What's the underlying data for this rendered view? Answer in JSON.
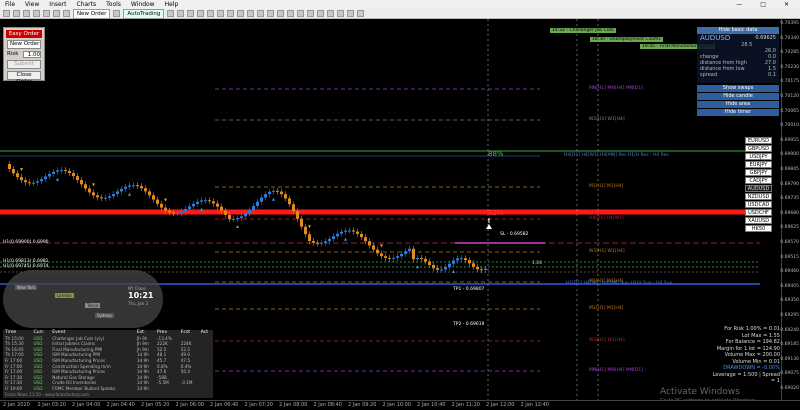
{
  "menu": [
    "File",
    "View",
    "Insert",
    "Charts",
    "Tools",
    "Window",
    "Help"
  ],
  "toolbar": {
    "new_order": "New Order",
    "auto_trading": "AutoTrading"
  },
  "easy_order": {
    "title": "Easy Order",
    "type": "New Order",
    "lots_label": "Risk",
    "lots_value": "1.00",
    "submit": "Submit",
    "close": "Close Order"
  },
  "info_panel": {
    "hide": "Hide basic data",
    "symbol": "AUDUSD",
    "price": "0.69625",
    "rows": [
      [
        "",
        "28.5"
      ],
      [
        "",
        "26.0"
      ],
      [
        "change",
        "0.0"
      ],
      [
        "distance from high",
        "27.0"
      ],
      [
        "distance from low",
        "1.5"
      ],
      [
        "spread",
        "0.1"
      ]
    ]
  },
  "right_buttons": [
    "Show swaps",
    "Hide candle",
    "Hide area",
    "Hide timer"
  ],
  "pairs": [
    "EURUSD",
    "GBPUSD",
    "USDJPY",
    "EURJPY",
    "GBPJPY",
    "CADJPY",
    "AUDUSD",
    "NZDUSD",
    "USDCAD",
    "USDCHF",
    "XAUUSD",
    "HK50"
  ],
  "pair_active": "AUDUSD",
  "chart": {
    "labels": {
      "fib88": "88%",
      "fib62": "62%",
      "sl": "SL - 0.69582",
      "tp1": "TP1 - 0.69807",
      "tp2": "TP2 - 0.69619",
      "count": "1:26"
    },
    "top_tags": [
      "14:32 - Challenger Job Cuts",
      "18:30 - Unemployment Claims",
      "19:45 - Final Manufacturing PMI"
    ],
    "level_labels": [
      "MN[H1] MN[H4] MN[D1]",
      "W1[H1] W1[H4]",
      "H4[D1] H4[W1] H4[MN] Res H1/H Res - H4 Res",
      "M1[H1] M1[H4]",
      "H4[D1] H4[W1]",
      "W1[H1] W1[H4]",
      "M1[H1] M1[H4]",
      "H1[D1] H4[W1] H4[MN] Sup H1/H Sup - H4 Sup",
      "M1[H1] M1[H4]",
      "W1[H1] W1[H4]",
      "MN[H1] MN[H4] MN[D1]"
    ],
    "left_tags": [
      "H1(0.69900) 0.6990",
      "H1(0.69813) 0.6981",
      "H1(0.69745) 0.6974"
    ]
  },
  "price_axis": [
    "0.70395",
    "0.70340",
    "0.70285",
    "0.70230",
    "0.70175",
    "0.70120",
    "0.70065",
    "0.70010",
    "0.69955",
    "0.69900",
    "0.69845",
    "0.69790",
    "0.69735",
    "0.69680",
    "0.69625",
    "0.69570",
    "0.69515",
    "0.69460",
    "0.69405",
    "0.69350",
    "0.69295",
    "0.69240",
    "0.69185",
    "0.69130",
    "0.69075",
    "0.69020"
  ],
  "time_axis": [
    "2 Jan 2020",
    "2 Jan 03:20",
    "2 Jan 04:00",
    "2 Jan 04:40",
    "2 Jan 05:20",
    "2 Jan 06:00",
    "2 Jan 06:40",
    "2 Jan 07:20",
    "2 Jan 08:00",
    "2 Jan 08:40",
    "2 Jan 09:20",
    "2 Jan 10:00",
    "2 Jan 10:40",
    "2 Jan 11:20",
    "2 Jan 12:00",
    "2 Jan 12:40"
  ],
  "clock": {
    "label": "NY Close",
    "time": "10:21",
    "date": "Thu, Jan 2"
  },
  "clock_tabs": [
    "New York",
    "London",
    "Tokyo",
    "Sydney"
  ],
  "news": {
    "headers": [
      "Time",
      "Curr.",
      "Event",
      "Est.",
      "Prev",
      "Fcst",
      "Act"
    ],
    "rows": [
      [
        "Th 15:00",
        "USD",
        "Challenger Job Cuts (y/y)",
        "Jh 9h",
        "-13.4%",
        "",
        ""
      ],
      [
        "Th 15:30",
        "USD",
        "Initial Jobless Claims",
        "Jh 9m",
        "222K",
        "224K",
        ""
      ],
      [
        "Th 16:45",
        "USD",
        "Final Manufacturing PMI",
        "Jh 9m",
        "52.5",
        "52.5",
        ""
      ],
      [
        "Th 17:00",
        "USD",
        "ISM Manufacturing PMI",
        "1d 9h",
        "48.1",
        "49.0",
        ""
      ],
      [
        "Fr 17:00",
        "USD",
        "ISM Manufacturing Prices",
        "1d 9h",
        "45.7",
        "47.5",
        ""
      ],
      [
        "Fr 17:00",
        "USD",
        "Construction Spending m/m",
        "1d 9h",
        "0.8%",
        "0.4%",
        ""
      ],
      [
        "Fr 17:00",
        "USD",
        "ISM Manufacturing Prices",
        "1d 9h",
        "47.6",
        "50.4",
        ""
      ],
      [
        "Fr 17:30",
        "USD",
        "Natural Gas Storage",
        "1d 9h",
        "-58B",
        "",
        ""
      ],
      [
        "Fr 17:30",
        "USD",
        "Crude Oil Inventories",
        "1d 9h",
        "-5.5M",
        "-3.1M",
        ""
      ],
      [
        "Fr 19:00",
        "USD",
        "FOMC Member Bullard Speaks",
        "1d 9h",
        "",
        "",
        ""
      ]
    ],
    "footer": "Forex News 11:50 - www.forexfactory.com"
  },
  "risk": {
    "lines": [
      "For Risk 1.00% = 0.01",
      "Lot Max = 1.55",
      "For Balance = 194.82",
      "Margin for 1 lot = 124.90",
      "Volume Max = 200.00",
      "Volume Min = 0.01",
      "DRAWDOWN = -0.00%",
      "Leverage = 1:500 | Spread = 1"
    ]
  },
  "watermark": {
    "title": "Activate Windows",
    "sub": "Go to PC settings to activate Windows."
  },
  "colors": {
    "bull": "#2a7de1",
    "bear": "#e08b1c",
    "resistance": "#ff2222",
    "support": "#2244aa",
    "green_line": "#33aa33"
  }
}
